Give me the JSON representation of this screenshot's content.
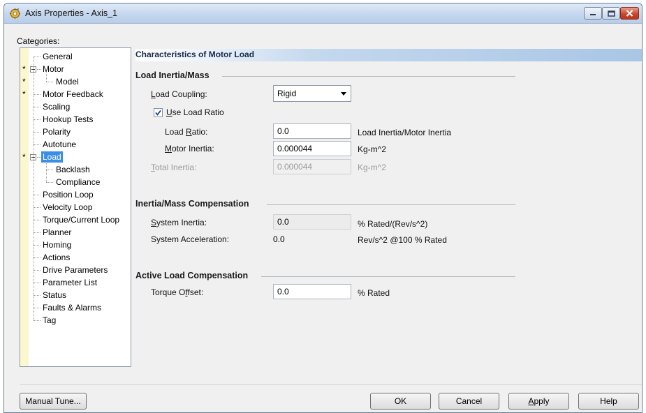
{
  "window": {
    "title": "Axis Properties - Axis_1"
  },
  "categories": {
    "label": "Categories:",
    "items": [
      {
        "label": "General",
        "starred": false,
        "level": 0,
        "expander": false,
        "selected": false
      },
      {
        "label": "Motor",
        "starred": true,
        "level": 0,
        "expander": true,
        "selected": false
      },
      {
        "label": "Model",
        "starred": true,
        "level": 1,
        "expander": false,
        "selected": false
      },
      {
        "label": "Motor Feedback",
        "starred": true,
        "level": 0,
        "expander": false,
        "selected": false
      },
      {
        "label": "Scaling",
        "starred": false,
        "level": 0,
        "expander": false,
        "selected": false
      },
      {
        "label": "Hookup Tests",
        "starred": false,
        "level": 0,
        "expander": false,
        "selected": false
      },
      {
        "label": "Polarity",
        "starred": false,
        "level": 0,
        "expander": false,
        "selected": false
      },
      {
        "label": "Autotune",
        "starred": false,
        "level": 0,
        "expander": false,
        "selected": false
      },
      {
        "label": "Load",
        "starred": true,
        "level": 0,
        "expander": true,
        "selected": true
      },
      {
        "label": "Backlash",
        "starred": false,
        "level": 1,
        "expander": false,
        "selected": false
      },
      {
        "label": "Compliance",
        "starred": false,
        "level": 1,
        "expander": false,
        "selected": false
      },
      {
        "label": "Position Loop",
        "starred": false,
        "level": 0,
        "expander": false,
        "selected": false
      },
      {
        "label": "Velocity Loop",
        "starred": false,
        "level": 0,
        "expander": false,
        "selected": false
      },
      {
        "label": "Torque/Current Loop",
        "starred": false,
        "level": 0,
        "expander": false,
        "selected": false
      },
      {
        "label": "Planner",
        "starred": false,
        "level": 0,
        "expander": false,
        "selected": false
      },
      {
        "label": "Homing",
        "starred": false,
        "level": 0,
        "expander": false,
        "selected": false
      },
      {
        "label": "Actions",
        "starred": false,
        "level": 0,
        "expander": false,
        "selected": false
      },
      {
        "label": "Drive Parameters",
        "starred": false,
        "level": 0,
        "expander": false,
        "selected": false
      },
      {
        "label": "Parameter List",
        "starred": false,
        "level": 0,
        "expander": false,
        "selected": false
      },
      {
        "label": "Status",
        "starred": false,
        "level": 0,
        "expander": false,
        "selected": false
      },
      {
        "label": "Faults & Alarms",
        "starred": false,
        "level": 0,
        "expander": false,
        "selected": false
      },
      {
        "label": "Tag",
        "starred": false,
        "level": 0,
        "expander": false,
        "selected": false
      }
    ]
  },
  "panel": {
    "header": "Characteristics of Motor Load",
    "load_inertia": {
      "title": "Load Inertia/Mass",
      "coupling_label": "Load Coupling:",
      "coupling_value": "Rigid",
      "use_ratio_label": "Use Load Ratio",
      "use_ratio_checked": true,
      "ratio_label": "Load Ratio:",
      "ratio_value": "0.0",
      "ratio_unit": "Load Inertia/Motor Inertia",
      "motor_inertia_label": "Motor Inertia:",
      "motor_inertia_value": "0.000044",
      "motor_inertia_unit": "Kg-m^2",
      "total_inertia_label": "Total Inertia:",
      "total_inertia_value": "0.000044",
      "total_inertia_unit": "Kg-m^2"
    },
    "compensation": {
      "title": "Inertia/Mass Compensation",
      "system_inertia_label": "System Inertia:",
      "system_inertia_value": "0.0",
      "system_inertia_unit": "% Rated/(Rev/s^2)",
      "system_accel_label": "System Acceleration:",
      "system_accel_value": "0.0",
      "system_accel_unit": "Rev/s^2 @100 % Rated"
    },
    "active_load": {
      "title": "Active Load Compensation",
      "torque_offset_label": "Torque Offset:",
      "torque_offset_value": "0.0",
      "torque_offset_unit": "% Rated"
    }
  },
  "buttons": {
    "manual_tune": "Manual Tune...",
    "ok": "OK",
    "cancel": "Cancel",
    "apply": "Apply",
    "help": "Help"
  },
  "colors": {
    "selection": "#3a8ee6",
    "header_gradient_end": "#a9c6e6",
    "close_button": "#c9432a"
  }
}
